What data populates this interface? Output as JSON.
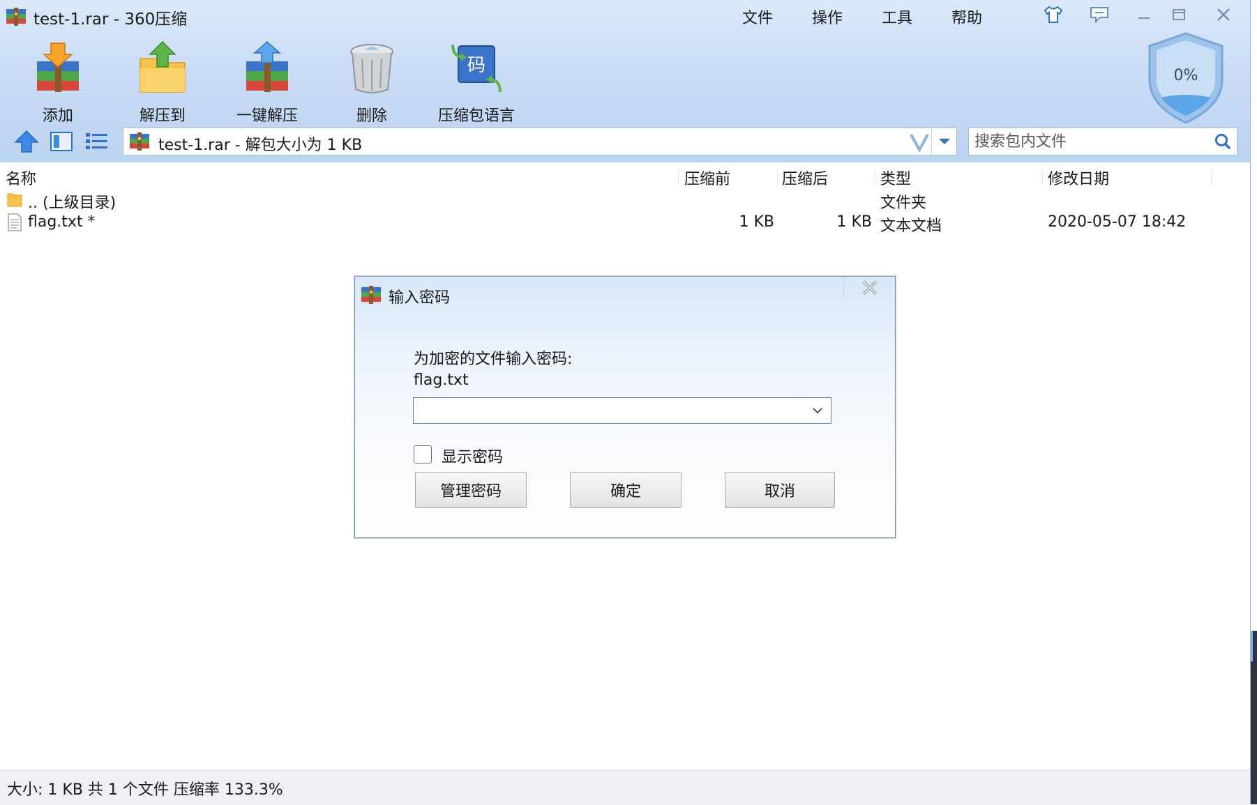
{
  "app": {
    "title": "test-1.rar - 360压缩"
  },
  "menu": {
    "file": "文件",
    "operate": "操作",
    "tools": "工具",
    "help": "帮助"
  },
  "toolbar": [
    {
      "label": "添加",
      "icon": "add-archive-icon"
    },
    {
      "label": "解压到",
      "icon": "extract-to-icon"
    },
    {
      "label": "一键解压",
      "icon": "one-click-extract-icon"
    },
    {
      "label": "删除",
      "icon": "delete-trash-icon"
    },
    {
      "label": "压缩包语言",
      "icon": "archive-language-icon"
    }
  ],
  "shield": {
    "percent": "0%"
  },
  "address": {
    "text": "test-1.rar - 解包大小为 1 KB"
  },
  "search": {
    "placeholder": "搜索包内文件"
  },
  "columns": {
    "name": "名称",
    "before": "压缩前",
    "after": "压缩后",
    "type": "类型",
    "modified": "修改日期"
  },
  "files": [
    {
      "name": ".. (上级目录)",
      "before": "",
      "after": "",
      "type": "文件夹",
      "modified": "",
      "icon": "folder-icon"
    },
    {
      "name": "flag.txt *",
      "before": "1 KB",
      "after": "1 KB",
      "type": "文本文档",
      "modified": "2020-05-07 18:42",
      "icon": "text-file-icon"
    }
  ],
  "status": {
    "text": "大小: 1 KB 共 1 个文件 压缩率 133.3%"
  },
  "dialog": {
    "title": "输入密码",
    "prompt": "为加密的文件输入密码:",
    "filename": "flag.txt",
    "password_value": "",
    "show_password_label": "显示密码",
    "manage_label": "管理密码",
    "ok_label": "确定",
    "cancel_label": "取消"
  },
  "colors": {
    "header_bg": "#c9dcf5",
    "accent": "#2f73c9",
    "status_bg": "#eef0f3"
  }
}
